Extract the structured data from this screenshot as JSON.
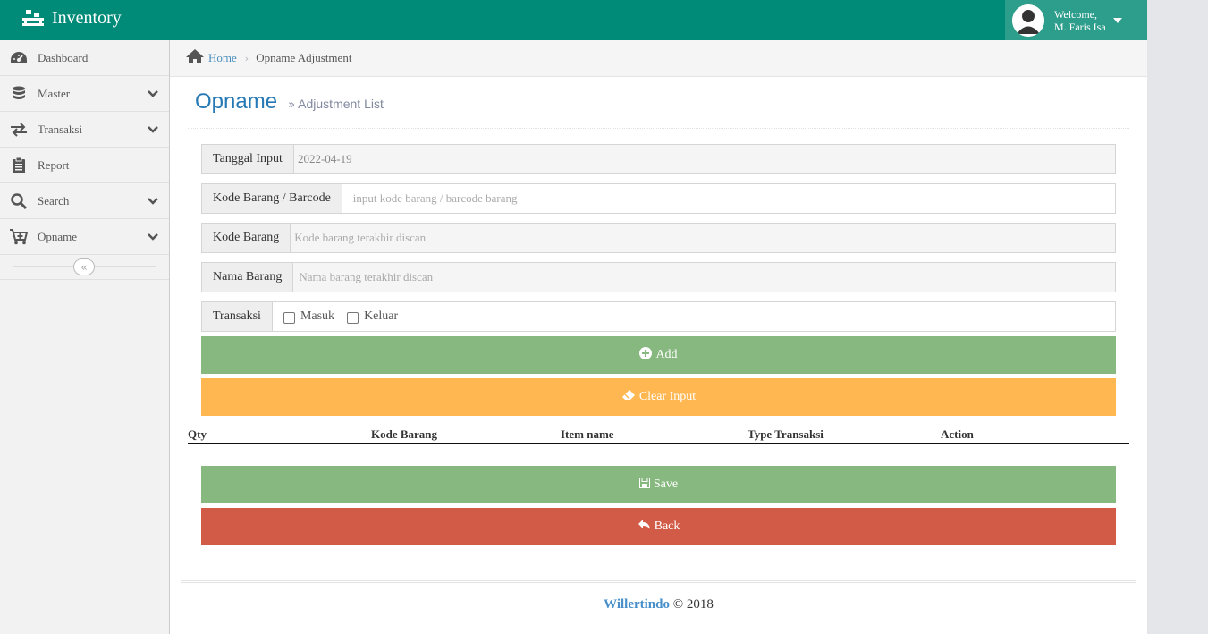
{
  "app": {
    "title": "Inventory"
  },
  "user": {
    "welcome": "Welcome,",
    "name": "M. Faris Isa"
  },
  "sidebar": {
    "items": [
      {
        "label": "Dashboard"
      },
      {
        "label": "Master"
      },
      {
        "label": "Transaksi"
      },
      {
        "label": "Report"
      },
      {
        "label": "Search"
      },
      {
        "label": "Opname"
      }
    ]
  },
  "breadcrumb": {
    "home": "Home",
    "current": "Opname Adjustment"
  },
  "page": {
    "title": "Opname",
    "subtitle": "Adjustment List"
  },
  "form": {
    "tanggal_label": "Tanggal Input",
    "tanggal_value": "2022-04-19",
    "kode_barcode_label": "Kode Barang / Barcode",
    "kode_barcode_placeholder": "input kode barang / barcode barang",
    "kode_label": "Kode Barang",
    "kode_placeholder": "Kode barang terakhir discan",
    "nama_label": "Nama Barang",
    "nama_placeholder": "Nama barang terakhir discan",
    "transaksi_label": "Transaksi",
    "masuk_label": "Masuk",
    "keluar_label": "Keluar"
  },
  "buttons": {
    "add": "Add",
    "clear": "Clear Input",
    "save": "Save",
    "back": "Back"
  },
  "table": {
    "columns": [
      "Qty",
      "Kode Barang",
      "Item name",
      "Type Transaksi",
      "Action"
    ]
  },
  "footer": {
    "brand": "Willertindo",
    "copyright": "© 2018"
  },
  "colors": {
    "navbar": "#008a78",
    "accent": "#2679b5",
    "green": "#87b87f",
    "orange": "#ffb752",
    "red": "#d15b47"
  }
}
